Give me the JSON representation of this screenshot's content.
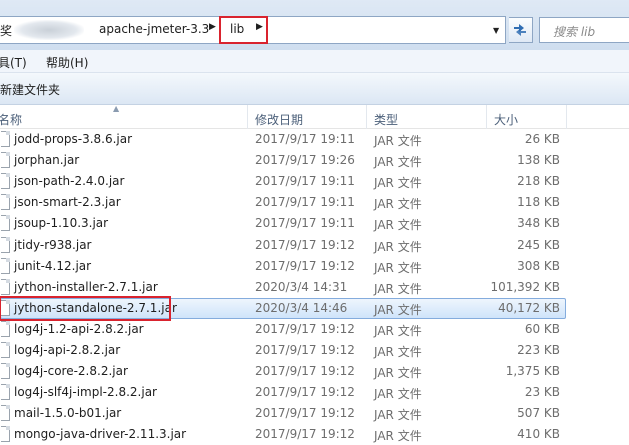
{
  "address_bar": {
    "partial_crumb": "奖",
    "crumbs": [
      "apache-jmeter-3.3",
      "lib"
    ],
    "search_placeholder": "搜索 lib"
  },
  "menu": [
    "具(T)",
    "帮助(H)"
  ],
  "command_bar": {
    "new_folder": "新建文件夹"
  },
  "columns": {
    "name": "名称",
    "date": "修改日期",
    "type": "类型",
    "size": "大小"
  },
  "highlight_color": "#d9232e",
  "files": [
    {
      "name": "jodd-props-3.8.6.jar",
      "date": "2017/9/17 19:11",
      "type": "JAR 文件",
      "size": "26 KB"
    },
    {
      "name": "jorphan.jar",
      "date": "2017/9/17 19:26",
      "type": "JAR 文件",
      "size": "138 KB"
    },
    {
      "name": "json-path-2.4.0.jar",
      "date": "2017/9/17 19:11",
      "type": "JAR 文件",
      "size": "218 KB"
    },
    {
      "name": "json-smart-2.3.jar",
      "date": "2017/9/17 19:11",
      "type": "JAR 文件",
      "size": "118 KB"
    },
    {
      "name": "jsoup-1.10.3.jar",
      "date": "2017/9/17 19:11",
      "type": "JAR 文件",
      "size": "348 KB"
    },
    {
      "name": "jtidy-r938.jar",
      "date": "2017/9/17 19:12",
      "type": "JAR 文件",
      "size": "245 KB"
    },
    {
      "name": "junit-4.12.jar",
      "date": "2017/9/17 19:12",
      "type": "JAR 文件",
      "size": "308 KB"
    },
    {
      "name": "jython-installer-2.7.1.jar",
      "date": "2020/3/4 14:31",
      "type": "JAR 文件",
      "size": "101,392 KB"
    },
    {
      "name": "jython-standalone-2.7.1.jar",
      "date": "2020/3/4 14:46",
      "type": "JAR 文件",
      "size": "40,172 KB"
    },
    {
      "name": "log4j-1.2-api-2.8.2.jar",
      "date": "2017/9/17 19:12",
      "type": "JAR 文件",
      "size": "60 KB"
    },
    {
      "name": "log4j-api-2.8.2.jar",
      "date": "2017/9/17 19:12",
      "type": "JAR 文件",
      "size": "223 KB"
    },
    {
      "name": "log4j-core-2.8.2.jar",
      "date": "2017/9/17 19:12",
      "type": "JAR 文件",
      "size": "1,375 KB"
    },
    {
      "name": "log4j-slf4j-impl-2.8.2.jar",
      "date": "2017/9/17 19:12",
      "type": "JAR 文件",
      "size": "23 KB"
    },
    {
      "name": "mail-1.5.0-b01.jar",
      "date": "2017/9/17 19:12",
      "type": "JAR 文件",
      "size": "507 KB"
    },
    {
      "name": "mongo-java-driver-2.11.3.jar",
      "date": "2017/9/17 19:12",
      "type": "JAR 文件",
      "size": "410 KB"
    }
  ]
}
